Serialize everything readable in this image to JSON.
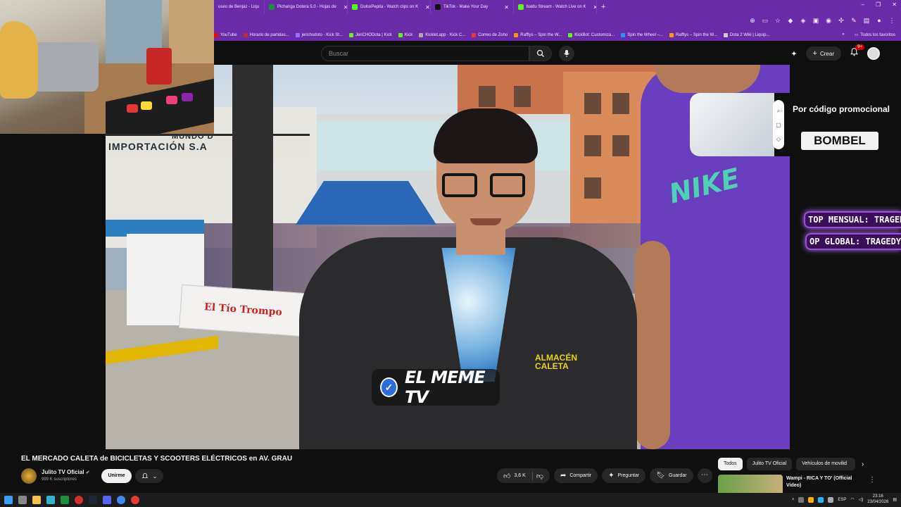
{
  "browser": {
    "tabs": [
      {
        "label": "useo de Benjaz - Liqu",
        "color": "#4285f4"
      },
      {
        "label": "Pichanga Dotera 5.0 - Hojas de",
        "color": "#1e8e3e"
      },
      {
        "label": "DulcePepita - Watch clips on K",
        "color": "#53fc18"
      },
      {
        "label": "TikTok - Make Your Day",
        "color": "#111111"
      },
      {
        "label": "baldu Stream - Watch Live on K",
        "color": "#53fc18"
      }
    ],
    "new_tab": "+",
    "window_controls": [
      "–",
      "❐",
      "✕"
    ],
    "bookmarks": [
      {
        "label": "YouTube",
        "color": "#ff0000"
      },
      {
        "label": "Horario de partidas...",
        "color": "#c62828"
      },
      {
        "label": "jerichodoto - Kick St...",
        "color": "#9c6bff"
      },
      {
        "label": "JeriCHODota | Kick",
        "color": "#53fc18"
      },
      {
        "label": "Kick",
        "color": "#53fc18"
      },
      {
        "label": "Kicklet.app - Kick C...",
        "color": "#aaaaaa"
      },
      {
        "label": "Correo de Zoho",
        "color": "#e53935"
      },
      {
        "label": "Rafflys – Spin the W...",
        "color": "#ff9800"
      },
      {
        "label": "KickBot: Customiza...",
        "color": "#53fc18"
      },
      {
        "label": "Spin the Wheel –...",
        "color": "#2196f3"
      },
      {
        "label": "Rafflys – Spin the W...",
        "color": "#ff9800"
      },
      {
        "label": "Dota 2 Wiki | Liquip...",
        "color": "#cccccc"
      }
    ],
    "bookmarks_more": "»",
    "all_favorites": "Todos los favoritos"
  },
  "youtube": {
    "search_placeholder": "Buscar",
    "create_label": "Crear",
    "notif_count": "9+"
  },
  "video": {
    "sign_text": "IMPORTACIÓN S.A",
    "sign_text_top": "MUNDO D",
    "banner_text": "El Tío Trompo",
    "logo_text": "ALMACÉN CALETA",
    "nike_text": "NIKE",
    "watermark_text": "EL MEME TV"
  },
  "overlay": {
    "promo_title": "Por código promocional",
    "promo_code": "BOMBEL",
    "rank_monthly": "TOP MENSUAL: TRAGEDY_",
    "rank_global": "OP GLOBAL: TRAGEDY_RK"
  },
  "info": {
    "title": "EL MERCADO CALETA de BICICLETAS Y SCOOTERS ELÉCTRICOS en AV. GRAU",
    "channel_name": "Julito TV Oficial",
    "subscribers": "999 K suscriptores",
    "join_label": "Unirme",
    "likes": "3,6 K",
    "share_label": "Compartir",
    "ask_label": "Preguntar",
    "save_label": "Guardar",
    "chips": [
      "Todos",
      "Julito TV Oficial",
      "Vehículos de movilid"
    ],
    "rec_title": "Wampi - RICA Y TO' (Official Video)"
  },
  "taskbar": {
    "lang": "ESP",
    "time": "23:16",
    "date": "23/04/2026"
  }
}
